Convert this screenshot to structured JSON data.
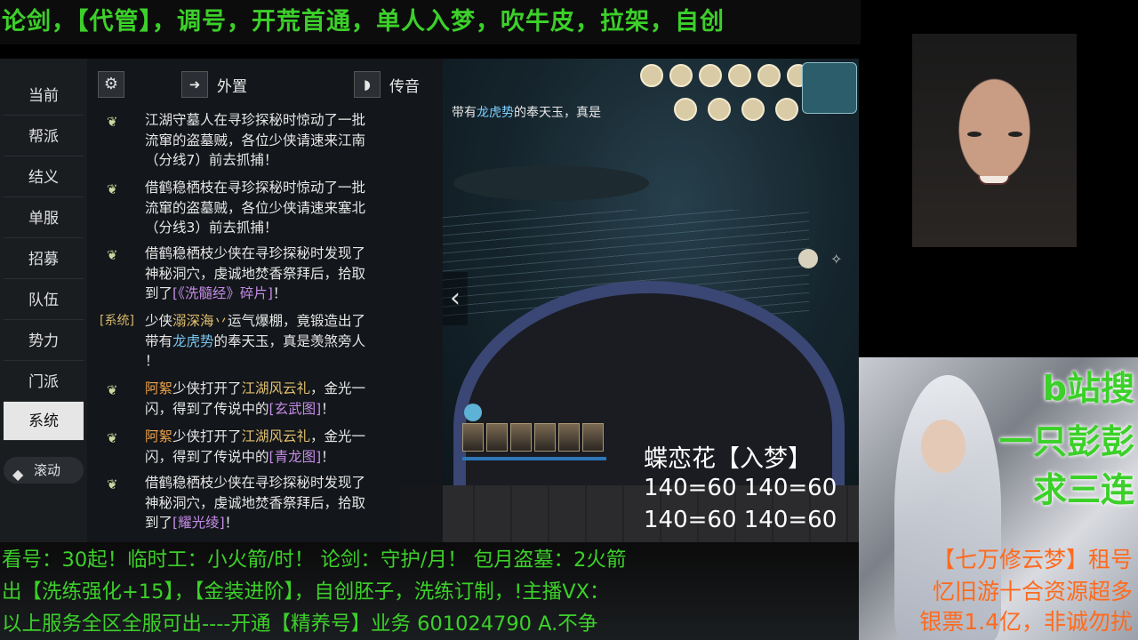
{
  "top_banner": "论剑，【代管】，调号，开荒首通，单人入梦，吹牛皮，拉架，自创",
  "sidebar": {
    "items": [
      "当前",
      "帮派",
      "结义",
      "单服",
      "招募",
      "队伍",
      "势力",
      "门派",
      "系统"
    ],
    "active": "系统",
    "scroll_label": "滚动"
  },
  "chat_header": {
    "external_label": "外置",
    "voice_label": "传音"
  },
  "messages": [
    {
      "lines": [
        "江湖守墓人在寻珍探秘时惊动了一批",
        "流窜的盗墓贼，各位少侠请速来江南",
        "（分线7）前去抓捕！"
      ]
    },
    {
      "lines": [
        "借鹤稳栖枝在寻珍探秘时惊动了一批",
        "流窜的盗墓贼，各位少侠请速来塞北",
        "（分线3）前去抓捕！"
      ]
    },
    {
      "lines": [
        "借鹤稳栖枝少侠在寻珍探秘时发现了",
        "神秘洞穴，虔诚地焚香祭拜后，拾取",
        "到了"
      ],
      "item": "[《洗髓经》碎片]",
      "tail": "！"
    },
    {
      "tag": "[系统]",
      "p1": "少侠",
      "name": "溺深海丷",
      "p2": "运气爆棚，竟锻造出了",
      "p3": "带有",
      "skill": "龙虎势",
      "p4": "的奉天玉，真是羡煞旁人",
      "p5": "！"
    },
    {
      "name": "阿絮",
      "p1": "少侠打开了",
      "gift": "江湖风云礼",
      "p2": "，金光一",
      "p3": "闪，得到了传说中的",
      "item": "[玄武图]",
      "tail": "！"
    },
    {
      "name": "阿絮",
      "p1": "少侠打开了",
      "gift": "江湖风云礼",
      "p2": "，金光一",
      "p3": "闪，得到了传说中的",
      "item": "[青龙图]",
      "tail": "！"
    },
    {
      "lines": [
        "借鹤稳栖枝少侠在寻珍探秘时发现了",
        "神秘洞穴，虔诚地焚香祭拜后，拾取",
        "到了"
      ],
      "item": "[耀光绫]",
      "tail": "！"
    }
  ],
  "scene_hint": {
    "pre": "带有",
    "skill": "龙虎势",
    "post": "的奉天玉，真是"
  },
  "overlay": {
    "title": "蝶恋花【入梦】",
    "line1": "140=60 140=60",
    "line2": "140=60 140=60"
  },
  "bottom_lines": [
    "看号：30起！临时工：小火箭/时！ 论剑：守护/月！ 包月盗墓：2火箭",
    "出【洗练强化+15】，【金装进阶】，自创胚子，洗练订制，!主播VX：",
    "以上服务全区全服可出----开通【精养号】业务      601024790 A.不争"
  ],
  "right_text": [
    "b站搜",
    "一只彭彭",
    "求三连"
  ],
  "right_ad": [
    "【七万修云梦】租号",
    "忆旧游十合资源超多",
    "银票1.4亿，非诚勿扰"
  ],
  "colors": {
    "banner_green": "#3cd02a",
    "item_purple": "#c48ce6",
    "name_yellow": "#e3c16e",
    "link_blue": "#77c3ee",
    "ad_orange": "#ff6a1e"
  }
}
